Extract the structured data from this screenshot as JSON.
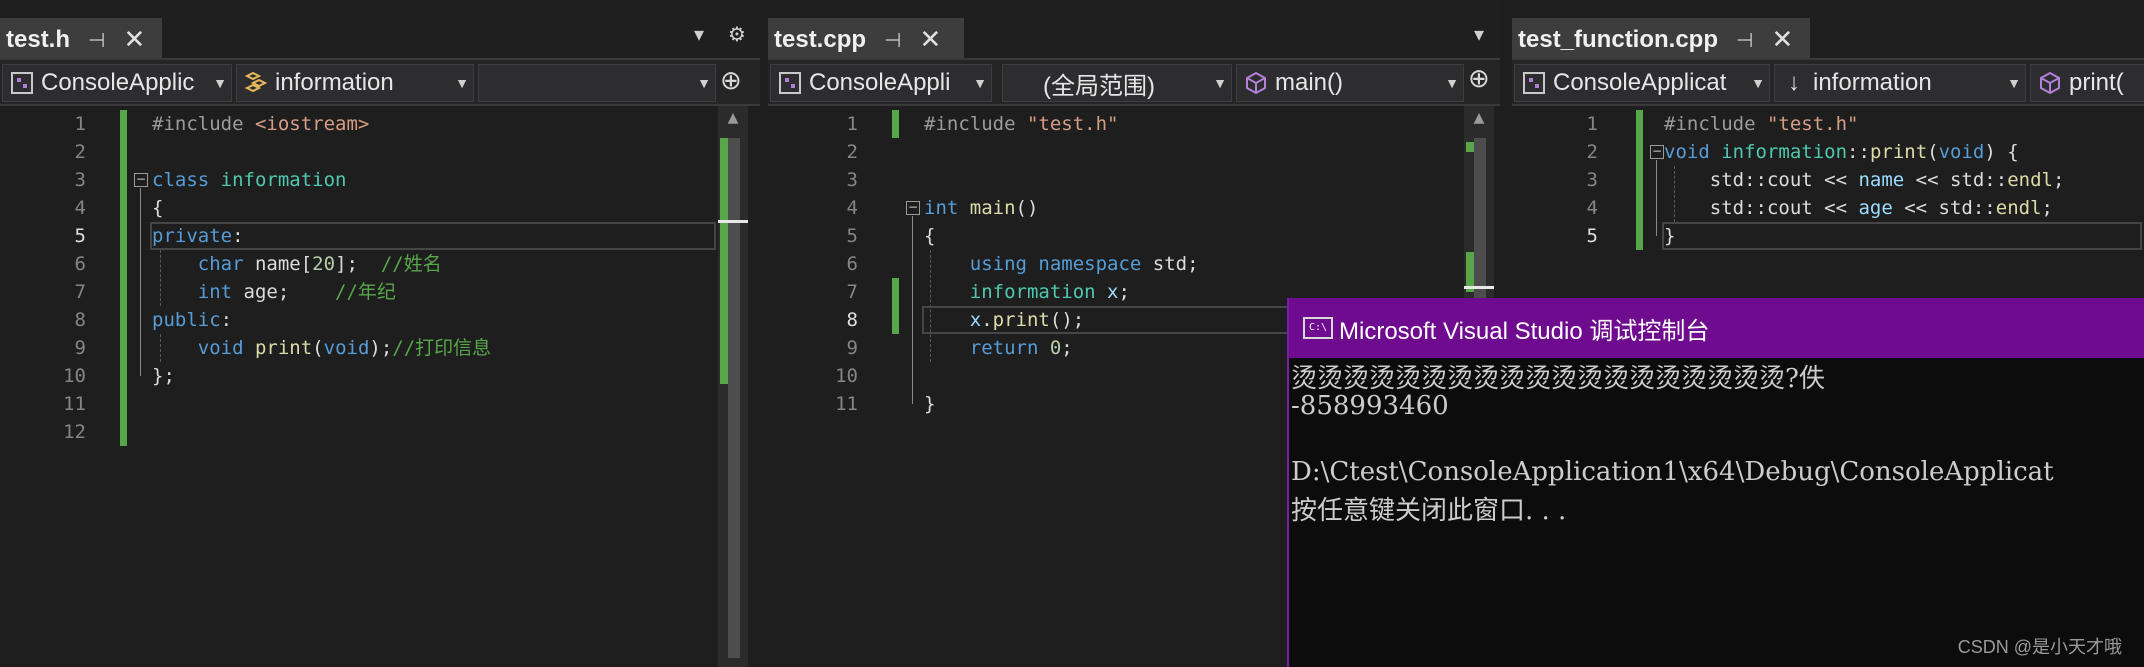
{
  "left": {
    "tab": "test.h",
    "nav": {
      "project": "ConsoleApplic",
      "scope": "information",
      "member": ""
    },
    "lines": [
      {
        "n": "1",
        "segs": [
          {
            "t": "#include ",
            "c": "pp"
          },
          {
            "t": "<iostream>",
            "c": "st"
          }
        ]
      },
      {
        "n": "2",
        "segs": []
      },
      {
        "n": "3",
        "segs": [
          {
            "t": "class ",
            "c": "kw"
          },
          {
            "t": "information",
            "c": "ty"
          }
        ]
      },
      {
        "n": "4",
        "segs": [
          {
            "t": "{",
            "c": ""
          }
        ]
      },
      {
        "n": "5",
        "segs": [
          {
            "t": "private",
            "c": "kw"
          },
          {
            "t": ":",
            "c": ""
          }
        ]
      },
      {
        "n": "6",
        "segs": [
          {
            "t": "    ",
            "c": ""
          },
          {
            "t": "char ",
            "c": "kw"
          },
          {
            "t": "name[",
            "c": ""
          },
          {
            "t": "20",
            "c": "nm"
          },
          {
            "t": "];  ",
            "c": ""
          },
          {
            "t": "//姓名",
            "c": "cm"
          }
        ]
      },
      {
        "n": "7",
        "segs": [
          {
            "t": "    ",
            "c": ""
          },
          {
            "t": "int ",
            "c": "kw"
          },
          {
            "t": "age;    ",
            "c": ""
          },
          {
            "t": "//年纪",
            "c": "cm"
          }
        ]
      },
      {
        "n": "8",
        "segs": [
          {
            "t": "public",
            "c": "kw"
          },
          {
            "t": ":",
            "c": ""
          }
        ]
      },
      {
        "n": "9",
        "segs": [
          {
            "t": "    ",
            "c": ""
          },
          {
            "t": "void ",
            "c": "kw"
          },
          {
            "t": "print",
            "c": "fn"
          },
          {
            "t": "(",
            "c": ""
          },
          {
            "t": "void",
            "c": "kw"
          },
          {
            "t": ");",
            "c": ""
          },
          {
            "t": "//打印信息",
            "c": "cm"
          }
        ]
      },
      {
        "n": "10",
        "segs": [
          {
            "t": "};",
            "c": ""
          }
        ]
      },
      {
        "n": "11",
        "segs": []
      },
      {
        "n": "12",
        "segs": []
      }
    ]
  },
  "middle": {
    "tab": "test.cpp",
    "nav": {
      "project": "ConsoleAppli",
      "scope": "(全局范围)",
      "member": "main()"
    },
    "lines": [
      {
        "n": "1",
        "segs": [
          {
            "t": "#include ",
            "c": "pp"
          },
          {
            "t": "\"test.h\"",
            "c": "st"
          }
        ]
      },
      {
        "n": "2",
        "segs": []
      },
      {
        "n": "3",
        "segs": []
      },
      {
        "n": "4",
        "segs": [
          {
            "t": "int ",
            "c": "kw"
          },
          {
            "t": "main",
            "c": "fn"
          },
          {
            "t": "()",
            "c": ""
          }
        ]
      },
      {
        "n": "5",
        "segs": [
          {
            "t": "{",
            "c": ""
          }
        ]
      },
      {
        "n": "6",
        "segs": [
          {
            "t": "    ",
            "c": ""
          },
          {
            "t": "using namespace ",
            "c": "kw"
          },
          {
            "t": "std;",
            "c": ""
          }
        ]
      },
      {
        "n": "7",
        "segs": [
          {
            "t": "    ",
            "c": ""
          },
          {
            "t": "information ",
            "c": "ty"
          },
          {
            "t": "x",
            "c": "vr"
          },
          {
            "t": ";",
            "c": ""
          }
        ]
      },
      {
        "n": "8",
        "segs": [
          {
            "t": "    ",
            "c": ""
          },
          {
            "t": "x",
            "c": "vr"
          },
          {
            "t": ".",
            "c": ""
          },
          {
            "t": "print",
            "c": "fn"
          },
          {
            "t": "();",
            "c": ""
          }
        ]
      },
      {
        "n": "9",
        "segs": [
          {
            "t": "    ",
            "c": ""
          },
          {
            "t": "return ",
            "c": "kw"
          },
          {
            "t": "0",
            "c": "nm"
          },
          {
            "t": ";",
            "c": ""
          }
        ]
      },
      {
        "n": "10",
        "segs": []
      },
      {
        "n": "11",
        "segs": [
          {
            "t": "}",
            "c": ""
          }
        ]
      }
    ]
  },
  "right": {
    "tab": "test_function.cpp",
    "nav": {
      "project": "ConsoleApplicat",
      "scope": "information",
      "member": "print("
    },
    "lines": [
      {
        "n": "1",
        "segs": [
          {
            "t": "#include ",
            "c": "pp"
          },
          {
            "t": "\"test.h\"",
            "c": "st"
          }
        ]
      },
      {
        "n": "2",
        "segs": [
          {
            "t": "void ",
            "c": "kw"
          },
          {
            "t": "information",
            "c": "ty"
          },
          {
            "t": "::",
            "c": ""
          },
          {
            "t": "print",
            "c": "fn"
          },
          {
            "t": "(",
            "c": ""
          },
          {
            "t": "void",
            "c": "kw"
          },
          {
            "t": ") {",
            "c": ""
          }
        ]
      },
      {
        "n": "3",
        "segs": [
          {
            "t": "    std::cout << ",
            "c": ""
          },
          {
            "t": "name",
            "c": "vr"
          },
          {
            "t": " << std::",
            "c": ""
          },
          {
            "t": "endl",
            "c": "fn"
          },
          {
            "t": ";",
            "c": ""
          }
        ]
      },
      {
        "n": "4",
        "segs": [
          {
            "t": "    std::cout << ",
            "c": ""
          },
          {
            "t": "age",
            "c": "vr"
          },
          {
            "t": " << std::",
            "c": ""
          },
          {
            "t": "endl",
            "c": "fn"
          },
          {
            "t": ";",
            "c": ""
          }
        ]
      },
      {
        "n": "5",
        "segs": [
          {
            "t": "}",
            "c": ""
          }
        ]
      }
    ]
  },
  "console": {
    "title": "Microsoft Visual Studio 调试控制台",
    "lines": [
      "烫烫烫烫烫烫烫烫烫烫烫烫烫烫烫烫烫烫烫?￼佚",
      "-858993460",
      "",
      "D:\\Ctest\\ConsoleApplication1\\x64\\Debug\\ConsoleApplicat",
      "按任意键关闭此窗口. . ."
    ]
  },
  "watermark": "CSDN @是小天才哦",
  "icons": {
    "pin": "pin-icon",
    "close": "close-icon",
    "dropdown": "chevron-down-icon",
    "gear": "gear-icon",
    "split": "split-editor-icon",
    "project": "project-icon",
    "class": "class-icon",
    "method": "method-icon",
    "console": "console-icon"
  },
  "colors": {
    "console_title": "#6f0b8e",
    "gutter_green": "#57a64a",
    "keyword": "#569cd6",
    "type": "#4ec9b0"
  }
}
